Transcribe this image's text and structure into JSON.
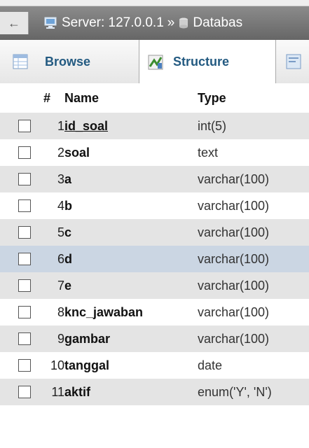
{
  "breadcrumb": {
    "server": "Server: 127.0.0.1",
    "separator": "»",
    "database": "Databas"
  },
  "tabs": [
    {
      "label": "Browse",
      "icon": "browse-table-icon"
    },
    {
      "label": "Structure",
      "icon": "structure-icon",
      "active": true
    },
    {
      "label": "",
      "icon": "sql-icon"
    }
  ],
  "columns_header": {
    "num": "#",
    "name": "Name",
    "type": "Type"
  },
  "rows": [
    {
      "num": "1",
      "name": "id_soal",
      "type": "int(5)",
      "primary": true
    },
    {
      "num": "2",
      "name": "soal",
      "type": "text"
    },
    {
      "num": "3",
      "name": "a",
      "type": "varchar(100)"
    },
    {
      "num": "4",
      "name": "b",
      "type": "varchar(100)"
    },
    {
      "num": "5",
      "name": "c",
      "type": "varchar(100)"
    },
    {
      "num": "6",
      "name": "d",
      "type": "varchar(100)",
      "highlighted": true
    },
    {
      "num": "7",
      "name": "e",
      "type": "varchar(100)"
    },
    {
      "num": "8",
      "name": "knc_jawaban",
      "type": "varchar(100)"
    },
    {
      "num": "9",
      "name": "gambar",
      "type": "varchar(100)"
    },
    {
      "num": "10",
      "name": "tanggal",
      "type": "date"
    },
    {
      "num": "11",
      "name": "aktif",
      "type": "enum('Y', 'N')"
    }
  ],
  "colors": {
    "tab_text": "#235a81",
    "server_bar": "#777777",
    "row_alt": "#e4e4e4",
    "row_highlight": "#cbd6e3"
  }
}
